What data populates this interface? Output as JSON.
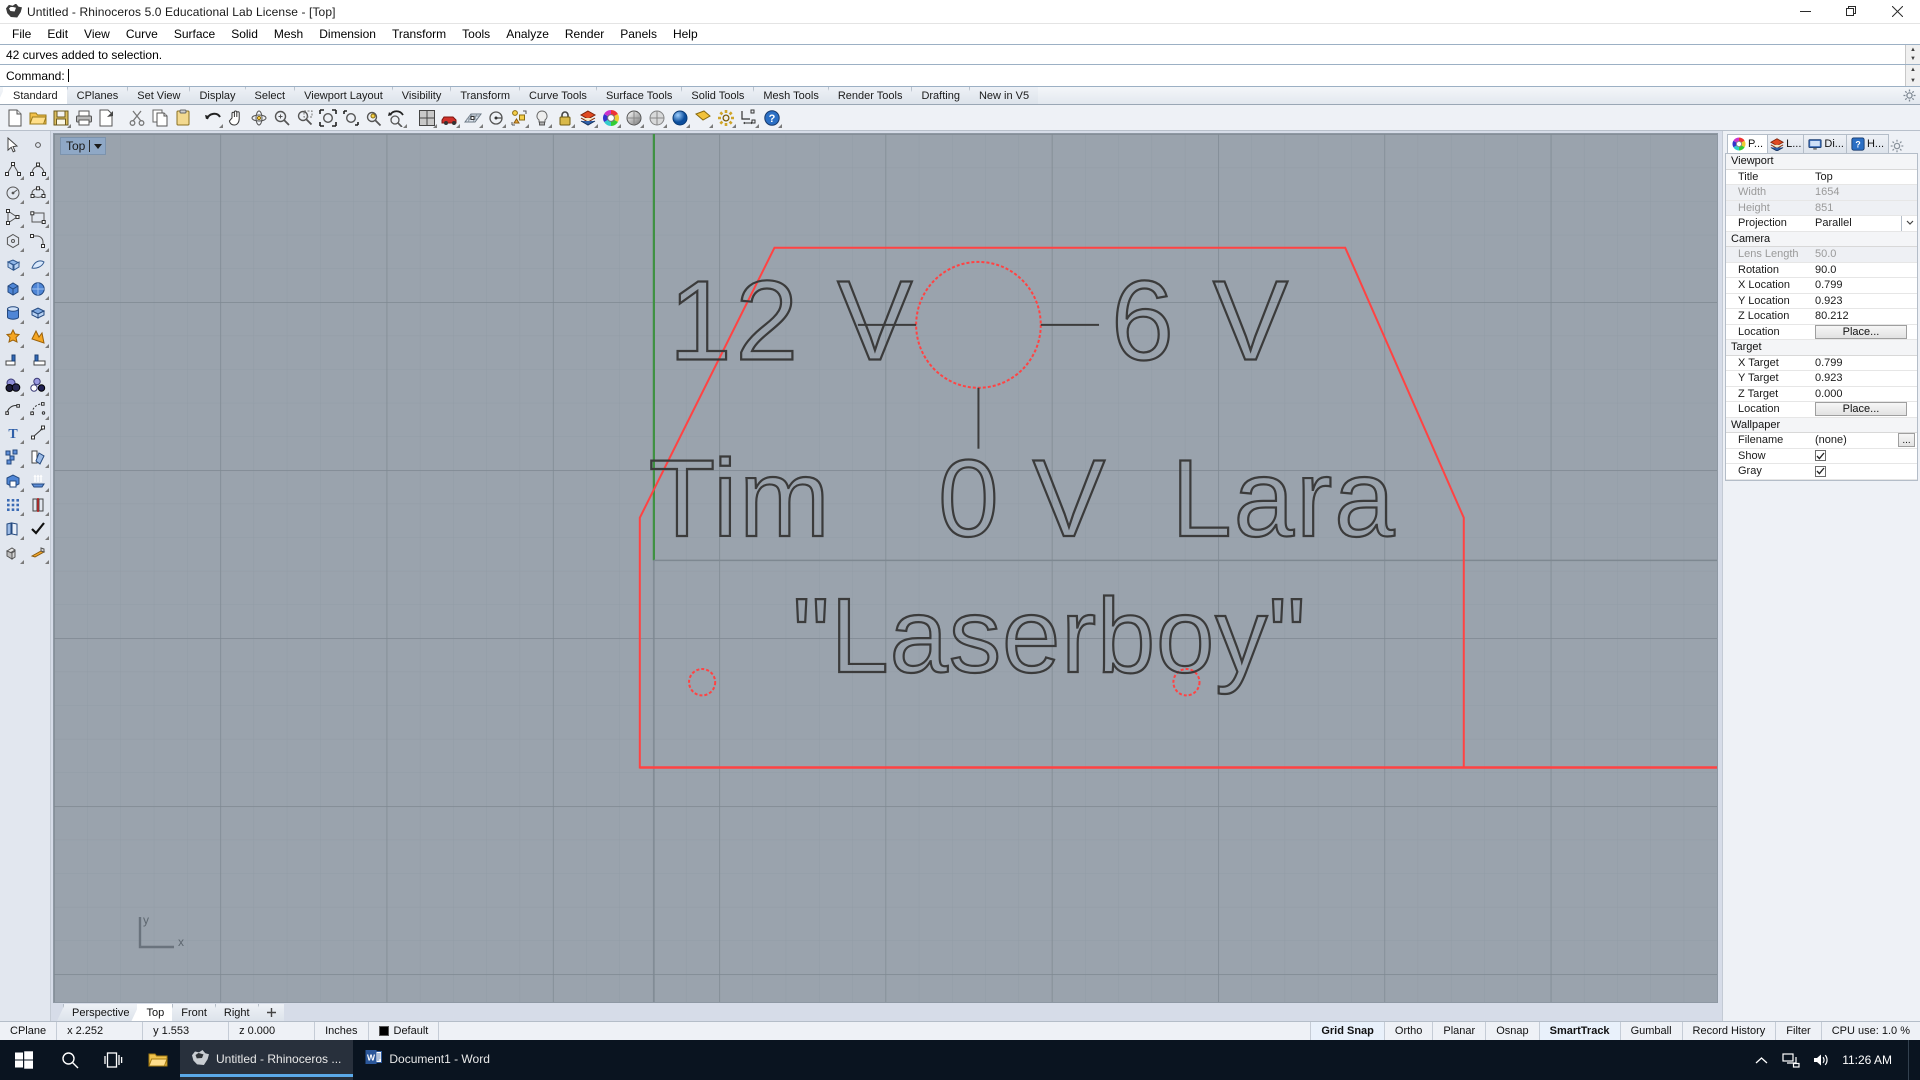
{
  "window": {
    "title": "Untitled - Rhinoceros 5.0 Educational Lab License - [Top]",
    "icon": "rhino-logo-icon",
    "buttons": {
      "minimize": "minimize-icon",
      "maximize": "restore-icon",
      "close": "close-icon"
    }
  },
  "menubar": {
    "items": [
      "File",
      "Edit",
      "View",
      "Curve",
      "Surface",
      "Solid",
      "Mesh",
      "Dimension",
      "Transform",
      "Tools",
      "Analyze",
      "Render",
      "Panels",
      "Help"
    ]
  },
  "command": {
    "history": "42 curves added to selection.",
    "prompt_label": "Command:",
    "input_value": ""
  },
  "toolbar_tabs": {
    "items": [
      "Standard",
      "CPlanes",
      "Set View",
      "Display",
      "Select",
      "Viewport Layout",
      "Visibility",
      "Transform",
      "Curve Tools",
      "Surface Tools",
      "Solid Tools",
      "Mesh Tools",
      "Render Tools",
      "Drafting",
      "New in V5"
    ],
    "active": "Standard",
    "options_icon": "gear-icon"
  },
  "main_toolbar": {
    "icons": [
      "new-file-icon",
      "open-folder-icon",
      "save-icon",
      "print-icon",
      "copy-to-clipboard-icon",
      "cut-scissors-icon",
      "copy-icon",
      "paste-icon",
      "undo-arrow-icon",
      "pan-hand-icon",
      "rotate-view-icon",
      "zoom-in-icon",
      "zoom-window-icon",
      "zoom-extents-icon",
      "zoom-selected-icon",
      "zoom-dynamic-icon",
      "zoom-previous-icon",
      "four-viewport-icon",
      "render-car-icon",
      "grid-snap-icon",
      "osnap-icon",
      "layout-icon",
      "light-bulb-icon",
      "lock-icon",
      "layers-icon",
      "color-wheel-icon",
      "shaded-sphere-icon",
      "ghosted-sphere-icon",
      "rendered-sphere-icon",
      "arctic-sphere-icon",
      "pen-icon",
      "options-gear-icon",
      "dimension-icon",
      "help-icon"
    ]
  },
  "left_toolbar": {
    "icons": [
      "select-arrow-icon",
      "select-point-icon",
      "polyline-icon",
      "curve-icon",
      "circle-icon",
      "ellipse-icon",
      "arc-icon",
      "rectangle-icon",
      "polygon-icon",
      "fillet-curve-icon",
      "surface-from-points-icon",
      "surface-sweep-icon",
      "box-icon",
      "sphere-icon",
      "cylinder-icon",
      "surface-array-icon",
      "boolean-union-icon",
      "boolean-difference-icon",
      "split-icon",
      "trim-icon",
      "boolean-spheres-icon",
      "set-group-icon",
      "blend-curve-icon",
      "curve-from-object-icon",
      "text-tool-icon",
      "dimension-leader-icon",
      "group-icon",
      "copy-objects-icon",
      "extrude-icon",
      "extrude-surface-icon",
      "array-icon",
      "mirror-icon",
      "page-layout-icon",
      "check-mark-icon",
      "unroll-icon",
      "render-flag-icon"
    ]
  },
  "viewport": {
    "label": "Top",
    "dropdown_icon": "chevron-down-icon",
    "axis": {
      "x_label": "x",
      "y_label": "y"
    },
    "tabs": [
      "Perspective",
      "Top",
      "Front",
      "Right"
    ],
    "active_tab": "Top",
    "add_tab_icon": "plus-icon",
    "background_color": "#9aa3ad",
    "grid_color": "#8e98a3",
    "selection_color": "#ff4040",
    "curve_color": "#3c3c3c",
    "cplane_x_axis_color": "#cc5c33",
    "cplane_y_axis_color": "#3f9142",
    "drawing": {
      "description": "Outlined CAD text curves inside a red-selected trapezoid profile",
      "texts": [
        "12 V",
        "6 V",
        "Tim",
        "0 V",
        "Lara",
        "\"Laserboy\""
      ],
      "circles_selected": 3
    }
  },
  "properties_panel": {
    "tabs": [
      {
        "label": "P...",
        "icon": "properties-color-wheel-icon",
        "active": true
      },
      {
        "label": "L...",
        "icon": "layers-icon",
        "active": false
      },
      {
        "label": "Di...",
        "icon": "display-monitor-icon",
        "active": false
      },
      {
        "label": "H...",
        "icon": "help-icon",
        "active": false
      }
    ],
    "options_icon": "gear-icon",
    "groups": [
      {
        "name": "Viewport",
        "rows": [
          {
            "key": "Title",
            "value": "Top",
            "type": "text",
            "disabled": false
          },
          {
            "key": "Width",
            "value": "1654",
            "type": "text",
            "disabled": true
          },
          {
            "key": "Height",
            "value": "851",
            "type": "text",
            "disabled": true
          },
          {
            "key": "Projection",
            "value": "Parallel",
            "type": "select",
            "disabled": false
          }
        ]
      },
      {
        "name": "Camera",
        "rows": [
          {
            "key": "Lens Length",
            "value": "50.0",
            "type": "text",
            "disabled": true
          },
          {
            "key": "Rotation",
            "value": "90.0",
            "type": "text",
            "disabled": false
          },
          {
            "key": "X Location",
            "value": "0.799",
            "type": "text",
            "disabled": false
          },
          {
            "key": "Y Location",
            "value": "0.923",
            "type": "text",
            "disabled": false
          },
          {
            "key": "Z Location",
            "value": "80.212",
            "type": "text",
            "disabled": false
          },
          {
            "key": "Location",
            "value": "Place...",
            "type": "button",
            "disabled": false
          }
        ]
      },
      {
        "name": "Target",
        "rows": [
          {
            "key": "X Target",
            "value": "0.799",
            "type": "text",
            "disabled": false
          },
          {
            "key": "Y Target",
            "value": "0.923",
            "type": "text",
            "disabled": false
          },
          {
            "key": "Z Target",
            "value": "0.000",
            "type": "text",
            "disabled": false
          },
          {
            "key": "Location",
            "value": "Place...",
            "type": "button",
            "disabled": false
          }
        ]
      },
      {
        "name": "Wallpaper",
        "rows": [
          {
            "key": "Filename",
            "value": "(none)",
            "type": "file",
            "disabled": false
          },
          {
            "key": "Show",
            "value": "",
            "type": "checkbox",
            "checked": true,
            "disabled": false
          },
          {
            "key": "Gray",
            "value": "",
            "type": "checkbox",
            "checked": true,
            "disabled": false
          }
        ]
      }
    ]
  },
  "statusbar": {
    "cplane_label": "CPlane",
    "x": "x 2.252",
    "y": "y 1.553",
    "z": "z 0.000",
    "units": "Inches",
    "layer": "Default",
    "layer_color": "#000000",
    "toggles": [
      {
        "label": "Grid Snap",
        "on": true
      },
      {
        "label": "Ortho",
        "on": false
      },
      {
        "label": "Planar",
        "on": false
      },
      {
        "label": "Osnap",
        "on": false
      },
      {
        "label": "SmartTrack",
        "on": true
      },
      {
        "label": "Gumball",
        "on": false
      },
      {
        "label": "Record History",
        "on": false
      },
      {
        "label": "Filter",
        "on": false
      }
    ],
    "cpu": "CPU use: 1.0 %"
  },
  "taskbar": {
    "start_icon": "windows-start-icon",
    "search_icon": "search-icon",
    "taskview_icon": "task-view-icon",
    "explorer_icon": "file-explorer-icon",
    "tasks": [
      {
        "label": "Untitled - Rhinoceros ...",
        "icon": "rhino-logo-icon",
        "active": true
      },
      {
        "label": "Document1 - Word",
        "icon": "word-icon",
        "active": false
      }
    ],
    "tray": {
      "chevron_icon": "chevron-up-icon",
      "network_icon": "network-icon",
      "volume_icon": "volume-icon",
      "clock": "11:26 AM"
    }
  }
}
